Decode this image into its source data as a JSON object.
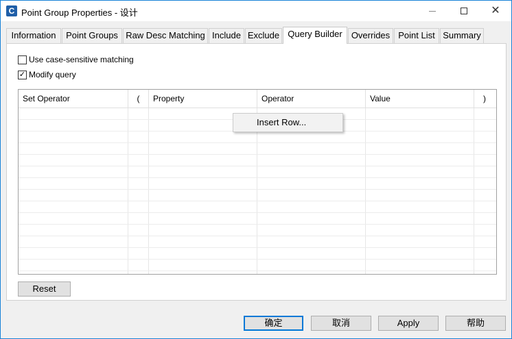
{
  "window": {
    "title": "Point Group Properties - 设计",
    "app_icon_letter": "C",
    "controls": {
      "minimize": "minimize-icon",
      "maximize": "maximize-icon",
      "close": "✕"
    }
  },
  "tabs": [
    {
      "label": "Information",
      "active": false
    },
    {
      "label": "Point Groups",
      "active": false
    },
    {
      "label": "Raw Desc Matching",
      "active": false
    },
    {
      "label": "Include",
      "active": false
    },
    {
      "label": "Exclude",
      "active": false
    },
    {
      "label": "Query Builder",
      "active": true
    },
    {
      "label": "Overrides",
      "active": false
    },
    {
      "label": "Point List",
      "active": false
    },
    {
      "label": "Summary",
      "active": false
    }
  ],
  "query_builder": {
    "case_sensitive": {
      "label": "Use case-sensitive matching",
      "checked": false
    },
    "modify_query": {
      "label": "Modify query",
      "checked": true,
      "check_glyph": "✓"
    },
    "columns": [
      "Set Operator",
      "(",
      "Property",
      "Operator",
      "Value",
      ")"
    ],
    "rows": [],
    "context_menu": {
      "items": [
        "Insert Row..."
      ]
    },
    "reset_label": "Reset"
  },
  "footer": {
    "ok_label": "确定",
    "cancel_label": "取消",
    "apply_label": "Apply",
    "help_label": "帮助"
  },
  "colors": {
    "accent": "#0078d7",
    "window_border": "#1883d7",
    "background": "#f0f0f0"
  }
}
